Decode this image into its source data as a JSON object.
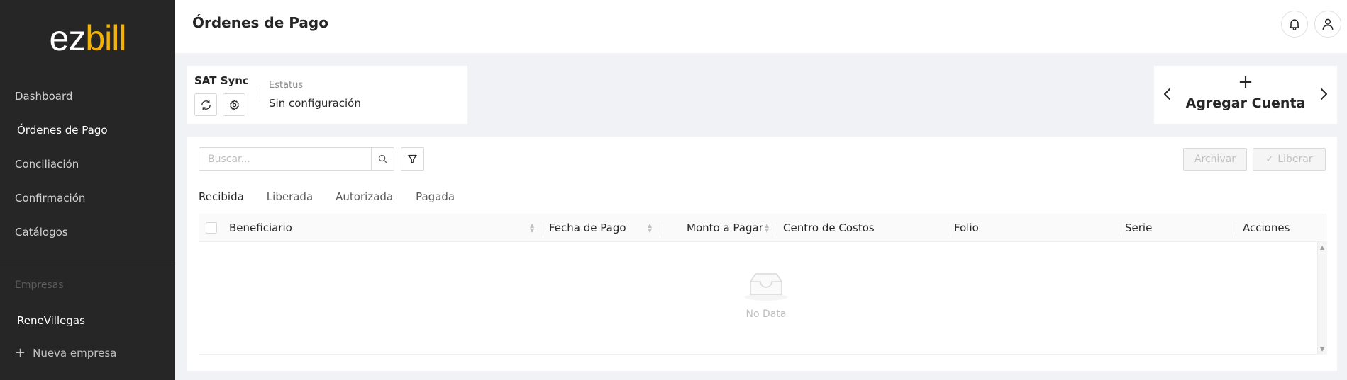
{
  "sidebar": {
    "logo": {
      "ez": "ez",
      "bill": "bill"
    },
    "items": [
      {
        "label": "Dashboard"
      },
      {
        "label": "Órdenes de Pago"
      },
      {
        "label": "Conciliación"
      },
      {
        "label": "Confirmación"
      },
      {
        "label": "Catálogos"
      }
    ],
    "section_label": "Empresas",
    "company": "ReneVillegas",
    "new_company": "Nueva empresa"
  },
  "header": {
    "title": "Órdenes de Pago",
    "icons": [
      "bell-icon",
      "user-icon"
    ]
  },
  "sat": {
    "title": "SAT Sync",
    "status_label": "Estatus",
    "status_value": "Sin configuración",
    "icons": [
      "sync-icon",
      "gear-icon"
    ]
  },
  "account": {
    "plus": "+",
    "label": "Agregar Cuenta"
  },
  "toolbar": {
    "search_placeholder": "Buscar...",
    "search_value": "",
    "archive_label": "Archivar",
    "release_label": "Liberar"
  },
  "tabs": [
    {
      "label": "Recibida",
      "active": true
    },
    {
      "label": "Liberada",
      "active": false
    },
    {
      "label": "Autorizada",
      "active": false
    },
    {
      "label": "Pagada",
      "active": false
    }
  ],
  "table": {
    "columns": [
      {
        "label": "Beneficiario"
      },
      {
        "label": "Fecha de Pago"
      },
      {
        "label": "Monto a Pagar"
      },
      {
        "label": "Centro de Costos"
      },
      {
        "label": "Folio"
      },
      {
        "label": "Serie"
      },
      {
        "label": "Acciones"
      }
    ],
    "rows": [],
    "empty_text": "No Data"
  },
  "colors": {
    "sidebar_bg": "#262626",
    "logo_accent": "#f5b301",
    "page_bg": "#f0f2f5"
  }
}
